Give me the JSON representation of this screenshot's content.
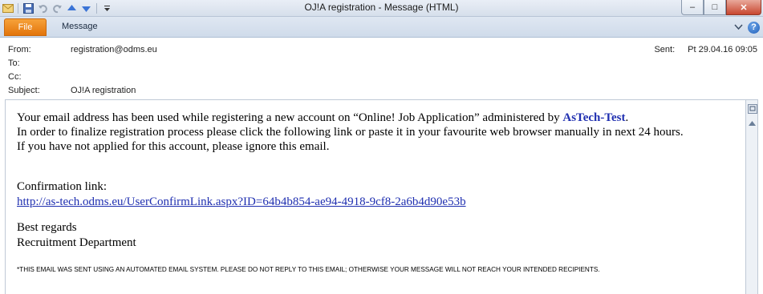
{
  "window": {
    "title": "OJ!A registration  -  Message (HTML)",
    "controls": {
      "minimize": "–",
      "maximize": "□",
      "close": "✕"
    }
  },
  "quick_access": {
    "icons": [
      "mail-icon",
      "save-icon",
      "undo-icon",
      "redo-icon",
      "previous-item-icon",
      "next-item-icon",
      "customize-icon"
    ]
  },
  "ribbon": {
    "file_tab": "File",
    "message_tab": "Message",
    "help": "?"
  },
  "header": {
    "from_label": "From:",
    "from_value": "registration@odms.eu",
    "to_label": "To:",
    "cc_label": "Cc:",
    "subject_label": "Subject:",
    "subject_value": "OJ!A registration",
    "sent_label": "Sent:",
    "sent_value": "Pt 29.04.16 09:05"
  },
  "body": {
    "line1_pre": "Your email address has been used while registering a new account on “Online! Job Application” administered by ",
    "line1_brand": "AsTech-Test",
    "line1_post": ".",
    "line2": "In order to finalize registration process please click the following link or paste it in your favourite web browser manually in next 24 hours.",
    "line3": "If you have not applied for this account, please ignore this email.",
    "confirmation_label": "Confirmation link:",
    "confirmation_link": "http://as-tech.odms.eu/UserConfirmLink.aspx?ID=64b4b854-ae94-4918-9cf8-2a6b4d90e53b",
    "regards": "Best regards",
    "department": "Recruitment Department",
    "footer_note": "*THIS EMAIL WAS SENT USING AN AUTOMATED EMAIL SYSTEM. PLEASE DO NOT REPLY TO THIS EMAIL; OTHERWISE YOUR MESSAGE WILL NOT REACH YOUR INTENDED RECIPIENTS."
  }
}
